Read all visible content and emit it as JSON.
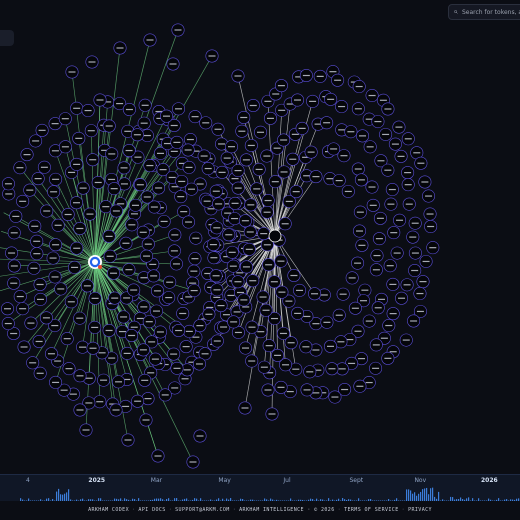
{
  "search": {
    "placeholder": "Search for tokens, a"
  },
  "timeline": {
    "labels": [
      {
        "text": "4",
        "pos": 0.05,
        "year": false
      },
      {
        "text": "2025",
        "pos": 0.17,
        "year": true
      },
      {
        "text": "Mar",
        "pos": 0.29,
        "year": false
      },
      {
        "text": "May",
        "pos": 0.42,
        "year": false
      },
      {
        "text": "Jul",
        "pos": 0.545,
        "year": false
      },
      {
        "text": "Sept",
        "pos": 0.672,
        "year": false
      },
      {
        "text": "Nov",
        "pos": 0.797,
        "year": false
      },
      {
        "text": "2026",
        "pos": 0.925,
        "year": true
      }
    ]
  },
  "footer": {
    "items": [
      "ARKHAM CODEX",
      "API DOCS",
      "SUPPORT@ARKM.COM",
      "ARKHAM INTELLIGENCE · © 2026",
      "TERMS OF SERVICE",
      "PRIVACY"
    ]
  },
  "colors": {
    "background": "#0b0d14",
    "green_edges": "#6fcf83",
    "white_edges": "#e6e6e6",
    "node_ring": "#5b4fd9",
    "timeline_bar": "#3c7dd9"
  }
}
